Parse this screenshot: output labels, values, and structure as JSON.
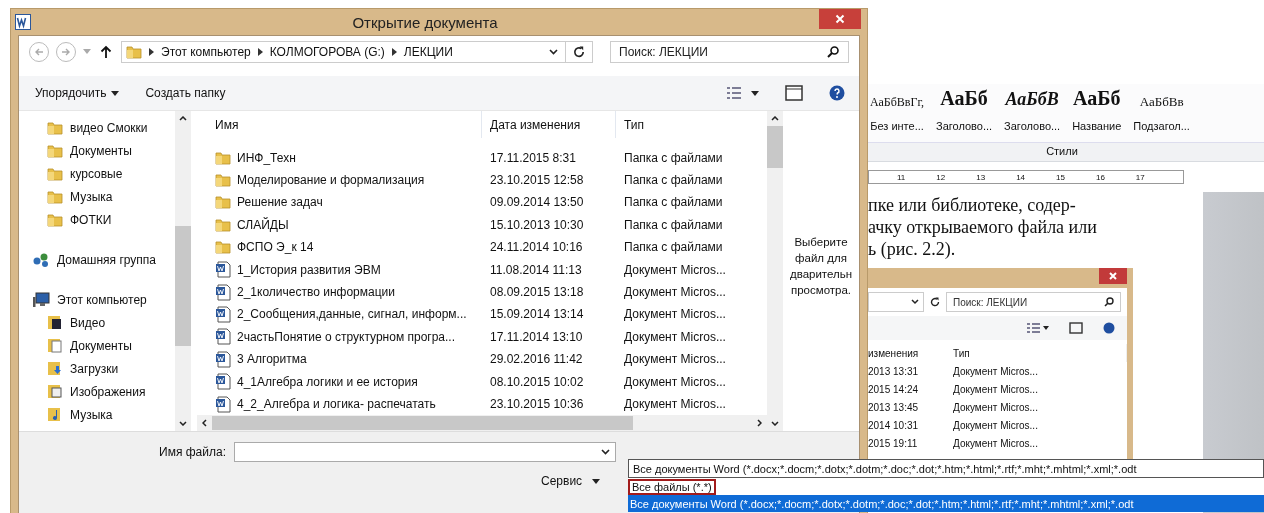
{
  "word_background": {
    "styles": [
      {
        "sample": "АаБбВвГг,",
        "name": "Без инте...",
        "kind": "normal"
      },
      {
        "sample": "АаБб",
        "name": "Заголово...",
        "kind": "heading1"
      },
      {
        "sample": "АаБбВ",
        "name": "Заголово...",
        "kind": "heading2"
      },
      {
        "sample": "АаБб",
        "name": "Название",
        "kind": "title"
      },
      {
        "sample": "АаБбВв",
        "name": "Подзагол...",
        "kind": "subtitle"
      }
    ],
    "styles_group": "Стили",
    "ruler": [
      "11",
      "12",
      "13",
      "14",
      "15",
      "16",
      "17"
    ],
    "text_lines": [
      "пке или библиотеке, содер-",
      "ачку открываемого файла или",
      "ь (рис. 2.2)."
    ],
    "figure": {
      "search_placeholder": "Поиск: ЛЕКЦИИ",
      "columns": [
        "изменения",
        "Тип"
      ],
      "rows": [
        {
          "date": "2013 13:31",
          "type": "Документ Micros..."
        },
        {
          "date": "2015 14:24",
          "type": "Документ Micros..."
        },
        {
          "date": "2013 13:45",
          "type": "Документ Micros..."
        },
        {
          "date": "2014 10:31",
          "type": "Документ Micros..."
        },
        {
          "date": "2015 19:11",
          "type": "Документ Micros..."
        }
      ]
    }
  },
  "dialog": {
    "title": "Открытие документа",
    "breadcrumbs": [
      "Этот компьютер",
      "КОЛМОГОРОВА (G:)",
      "ЛЕКЦИИ"
    ],
    "search_placeholder": "Поиск: ЛЕКЦИИ",
    "toolbar": {
      "organize": "Упорядочить",
      "new_folder": "Создать папку"
    },
    "nav_pane": [
      {
        "children": [
          {
            "label": "видео Смокки",
            "kind": "folder"
          },
          {
            "label": "Документы",
            "kind": "folder"
          },
          {
            "label": "курсовые",
            "kind": "folder"
          },
          {
            "label": "Музыка",
            "kind": "folder"
          },
          {
            "label": "ФОТКИ",
            "kind": "folder"
          }
        ]
      },
      {
        "label": "Домашняя группа",
        "kind": "homegroup"
      },
      {
        "label": "Этот компьютер",
        "kind": "computer",
        "children": [
          {
            "label": "Видео",
            "kind": "video"
          },
          {
            "label": "Документы",
            "kind": "documents"
          },
          {
            "label": "Загрузки",
            "kind": "downloads"
          },
          {
            "label": "Изображения",
            "kind": "pictures"
          },
          {
            "label": "Музыка",
            "kind": "music"
          }
        ]
      }
    ],
    "columns": [
      "Имя",
      "Дата изменения",
      "Тип"
    ],
    "rows": [
      {
        "name": "ИНФ_Техн",
        "date": "17.11.2015 8:31",
        "type": "Папка с файлами",
        "kind": "folder"
      },
      {
        "name": "Моделирование и формализация",
        "date": "23.10.2015 12:58",
        "type": "Папка с файлами",
        "kind": "folder"
      },
      {
        "name": "Решение задач",
        "date": "09.09.2014 13:50",
        "type": "Папка с файлами",
        "kind": "folder"
      },
      {
        "name": "СЛАЙДЫ",
        "date": "15.10.2013 10:30",
        "type": "Папка с файлами",
        "kind": "folder"
      },
      {
        "name": "ФСПО Э_к 14",
        "date": "24.11.2014 10:16",
        "type": "Папка с файлами",
        "kind": "folder"
      },
      {
        "name": "1_История развития ЭВМ",
        "date": "11.08.2014 11:13",
        "type": "Документ Micros...",
        "kind": "word"
      },
      {
        "name": "2_1количество информации",
        "date": "08.09.2015 13:18",
        "type": "Документ Micros...",
        "kind": "word"
      },
      {
        "name": "2_Сообщения,данные, сигнал, информ...",
        "date": "15.09.2014 13:14",
        "type": "Документ Micros...",
        "kind": "word"
      },
      {
        "name": "2частьПонятие о структурном програ...",
        "date": "17.11.2014 13:10",
        "type": "Документ Micros...",
        "kind": "word"
      },
      {
        "name": "3 Алгоритма",
        "date": "29.02.2016 11:42",
        "type": "Документ Micros...",
        "kind": "word"
      },
      {
        "name": "4_1Алгебра логики и ее история",
        "date": "08.10.2015 10:02",
        "type": "Документ Micros...",
        "kind": "word"
      },
      {
        "name": "4_2_Алгебра и логика- распечатать",
        "date": "23.10.2015 10:36",
        "type": "Документ Micros...",
        "kind": "word"
      }
    ],
    "preview_lines": [
      "Выберите",
      "файл для",
      "дварительн",
      "просмотра."
    ],
    "filename_label": "Имя файла:",
    "service_button": "Сервис",
    "file_type": {
      "value": "Все документы Word (*.docx;*.docm;*.dotx;*.dotm;*.doc;*.dot;*.htm;*.html;*.rtf;*.mht;*.mhtml;*.xml;*.odt",
      "options": [
        {
          "label": "Все файлы (*.*)",
          "selected": false,
          "outlined": true
        },
        {
          "label": "Все документы Word (*.docx;*.docm;*.dotx;*.dotm;*.doc;*.dot;*.htm;*.html;*.rtf;*.mht;*.mhtml;*.xml;*.odt",
          "selected": true,
          "outlined": false
        }
      ]
    }
  }
}
